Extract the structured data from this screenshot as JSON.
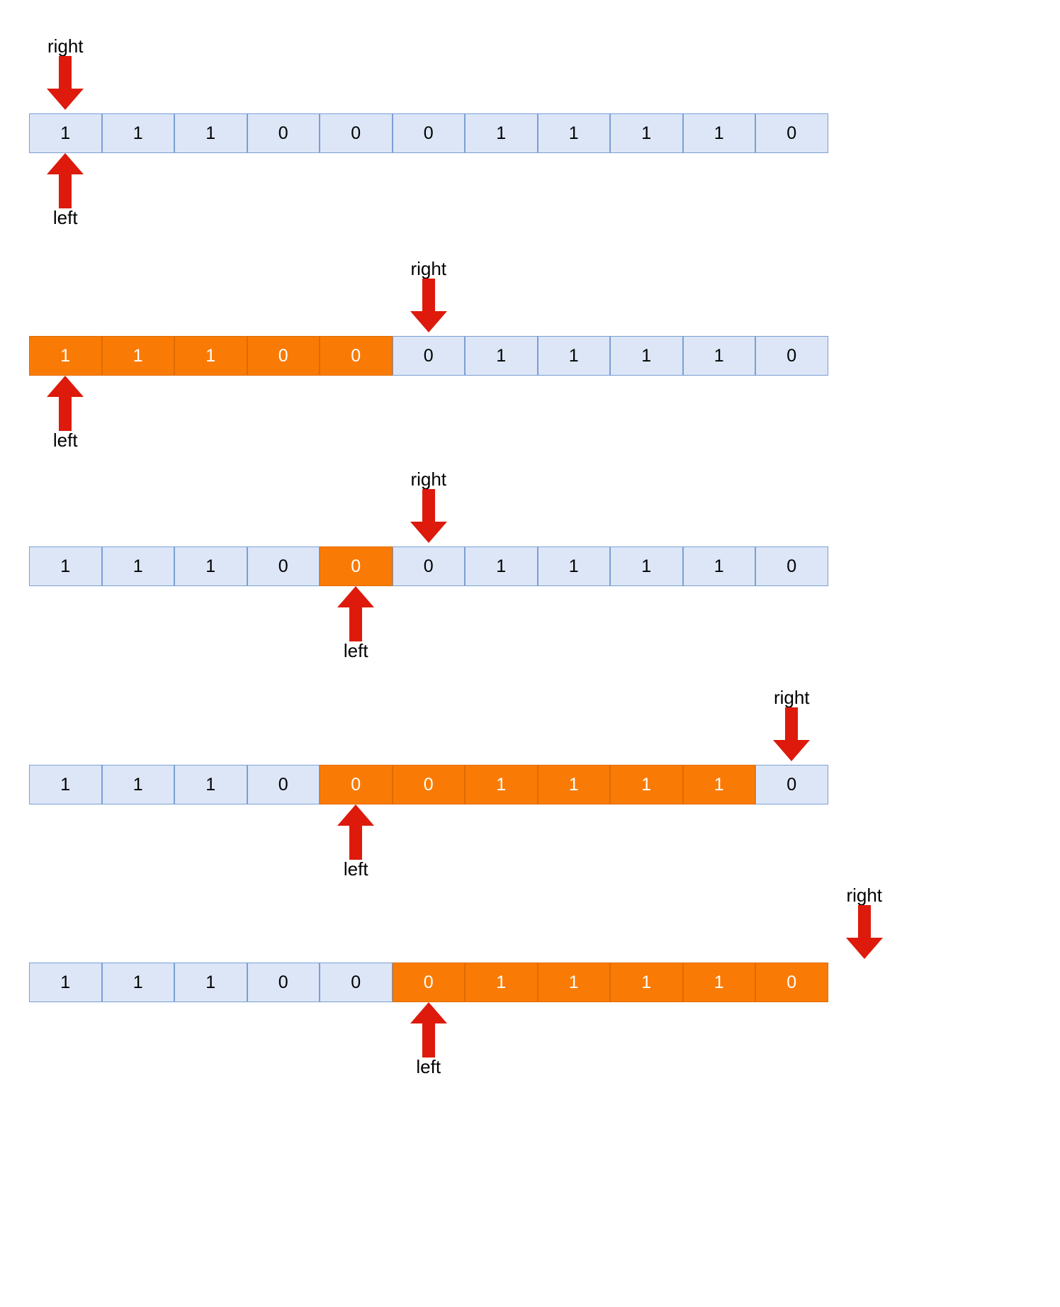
{
  "diagram": {
    "title_visible": false,
    "colors": {
      "cell_fill": "#dce6f7",
      "cell_border": "#7b9fd4",
      "highlight_fill": "#f97b05",
      "highlight_border": "#e06a00",
      "arrow": "#dd1a0b",
      "text": "#000000",
      "highlight_text": "#ffffff",
      "background": "#ffffff"
    },
    "labels": {
      "left": "left",
      "right": "right"
    },
    "array_length": 11,
    "steps": [
      {
        "step": 1,
        "values": [
          "1",
          "1",
          "1",
          "0",
          "0",
          "0",
          "1",
          "1",
          "1",
          "1",
          "0"
        ],
        "highlighted": [],
        "left_index": 0,
        "right_index": 0,
        "left_label": "left",
        "right_label": "right"
      },
      {
        "step": 2,
        "values": [
          "1",
          "1",
          "1",
          "0",
          "0",
          "0",
          "1",
          "1",
          "1",
          "1",
          "0"
        ],
        "highlighted": [
          0,
          1,
          2,
          3,
          4
        ],
        "left_index": 0,
        "right_index": 5,
        "left_label": "left",
        "right_label": "right"
      },
      {
        "step": 3,
        "values": [
          "1",
          "1",
          "1",
          "0",
          "0",
          "0",
          "1",
          "1",
          "1",
          "1",
          "0"
        ],
        "highlighted": [
          4
        ],
        "left_index": 4,
        "right_index": 5,
        "left_label": "left",
        "right_label": "right"
      },
      {
        "step": 4,
        "values": [
          "1",
          "1",
          "1",
          "0",
          "0",
          "0",
          "1",
          "1",
          "1",
          "1",
          "0"
        ],
        "highlighted": [
          4,
          5,
          6,
          7,
          8,
          9
        ],
        "left_index": 4,
        "right_index": 10,
        "left_label": "left",
        "right_label": "right"
      },
      {
        "step": 5,
        "values": [
          "1",
          "1",
          "1",
          "0",
          "0",
          "0",
          "1",
          "1",
          "1",
          "1",
          "0"
        ],
        "highlighted": [
          5,
          6,
          7,
          8,
          9,
          10
        ],
        "left_index": 5,
        "right_index": 11,
        "left_label": "left",
        "right_label": "right"
      }
    ]
  }
}
